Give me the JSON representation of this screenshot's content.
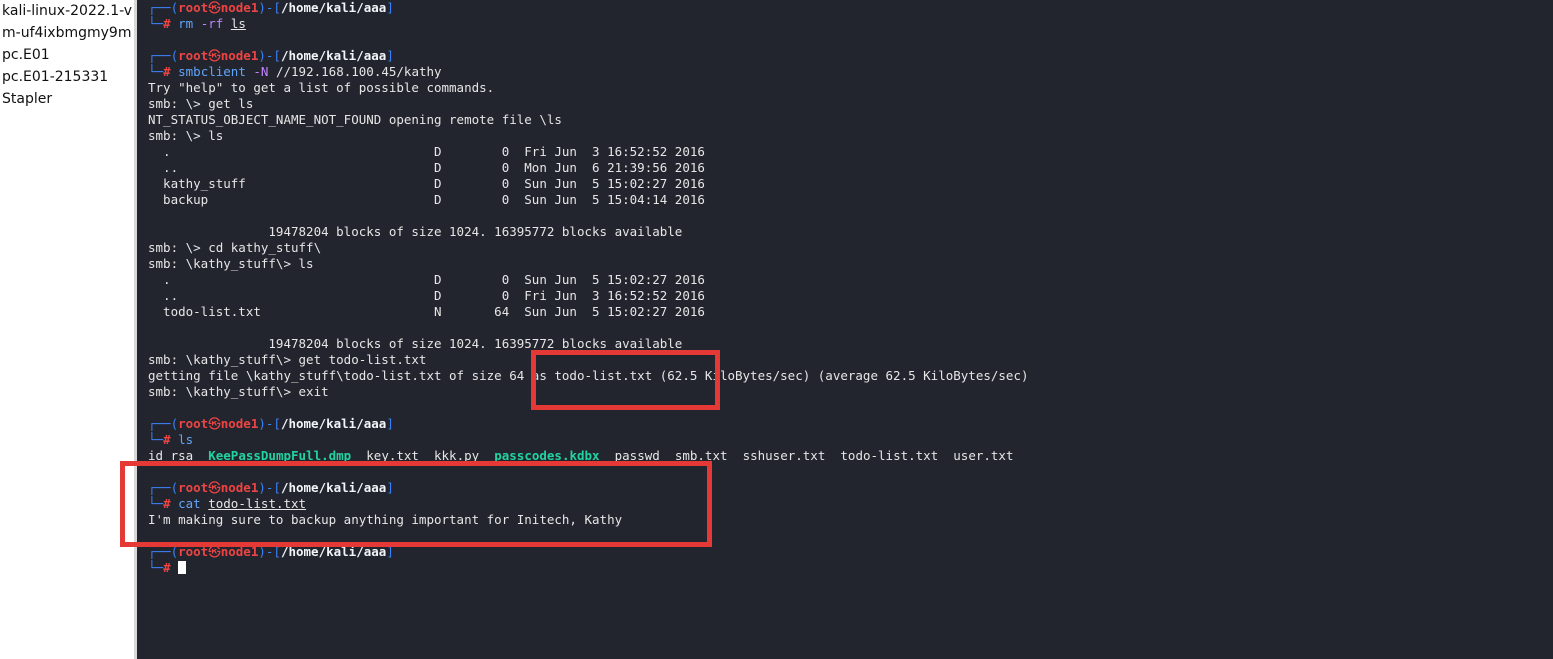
{
  "sidebar": {
    "items": [
      {
        "label": "kali-linux-2022.1-v"
      },
      {
        "label": "m-uf4ixbmgmy9m"
      },
      {
        "label": "pc.E01"
      },
      {
        "label": "pc.E01-215331"
      },
      {
        "label": "Stapler"
      }
    ]
  },
  "prompt": {
    "box_top": "┌──(",
    "user": "root",
    "skull": "㉿",
    "host": "node1",
    "bracket": ")-[",
    "path": "/home/kali/aaa",
    "close": "]",
    "box_bottom": "└─",
    "hash": "#"
  },
  "lines": {
    "l2_cmd": "rm",
    "l2_flag": "-rf",
    "l2_arg": "ls",
    "l4_cmd": "smbclient",
    "l4_flag": "-N",
    "l4_arg": "//192.168.100.45/kathy",
    "l5": "Try \"help\" to get a list of possible commands.",
    "l6": "smb: \\> get ls",
    "l7": "NT_STATUS_OBJECT_NAME_NOT_FOUND opening remote file \\ls",
    "l8": "smb: \\> ls",
    "l9": "  .                                   D        0  Fri Jun  3 16:52:52 2016",
    "l10": "  ..                                  D        0  Mon Jun  6 21:39:56 2016",
    "l11": "  kathy_stuff                         D        0  Sun Jun  5 15:02:27 2016",
    "l12": "  backup                              D        0  Sun Jun  5 15:04:14 2016",
    "l14": "                19478204 blocks of size 1024. 16395772 blocks available",
    "l15": "smb: \\> cd kathy_stuff\\",
    "l16": "smb: \\kathy_stuff\\> ls",
    "l17": "  .                                   D        0  Sun Jun  5 15:02:27 2016",
    "l18": "  ..                                  D        0  Fri Jun  3 16:52:52 2016",
    "l19": "  todo-list.txt                       N       64  Sun Jun  5 15:02:27 2016",
    "l21": "                19478204 blocks of size 1024. 16395772 blocks available",
    "l22": "smb: \\kathy_stuff\\> get todo-list.txt",
    "l23": "getting file \\kathy_stuff\\todo-list.txt of size 64 as todo-list.txt (62.5 KiloBytes/sec) (average 62.5 KiloBytes/sec)",
    "l24": "smb: \\kathy_stuff\\> exit",
    "l26_cmd": "ls",
    "l27_a": "id_rsa  ",
    "l27_b": "KeePassDumpFull.dmp",
    "l27_c": "  key.txt  kkk.py  ",
    "l27_d": "passcodes.kdbx",
    "l27_e": "  passwd  smb.txt  sshuser.txt  todo-list.txt  user.txt",
    "l29_cmd": "cat",
    "l29_arg": "todo-list.txt",
    "l30": "I'm making sure to backup anything important for Initech, Kathy"
  },
  "colors": {
    "terminal_bg": "#23252e",
    "highlight_box": "#e53935",
    "prompt_red": "#ef4444",
    "prompt_blue": "#3b82f6",
    "file_green": "#22d3a0"
  }
}
